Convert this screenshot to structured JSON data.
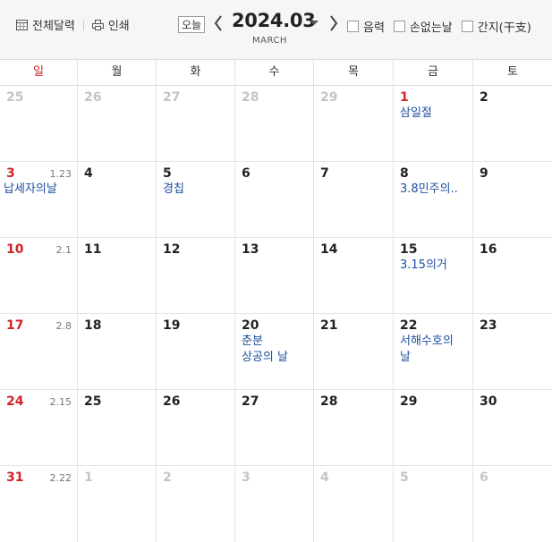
{
  "toolbar": {
    "full_calendar_label": "전체달력",
    "print_label": "인쇄",
    "today_label": "오늘",
    "year_month": "2024.03",
    "month_english": "MARCH",
    "options": [
      "음력",
      "손없는날",
      "간지(干支)"
    ]
  },
  "calendar": {
    "weekdays": [
      "일",
      "월",
      "화",
      "수",
      "목",
      "금",
      "토"
    ],
    "weeks": [
      [
        {
          "day": "25",
          "other": true
        },
        {
          "day": "26",
          "other": true
        },
        {
          "day": "27",
          "other": true
        },
        {
          "day": "28",
          "other": true
        },
        {
          "day": "29",
          "other": true
        },
        {
          "day": "1",
          "holiday": true,
          "events": [
            "삼일절"
          ]
        },
        {
          "day": "2"
        }
      ],
      [
        {
          "day": "3",
          "lunar": "1.23",
          "events": [
            "납세자의날"
          ]
        },
        {
          "day": "4"
        },
        {
          "day": "5",
          "events": [
            "경칩"
          ]
        },
        {
          "day": "6"
        },
        {
          "day": "7"
        },
        {
          "day": "8",
          "events": [
            "3.8민주의.."
          ]
        },
        {
          "day": "9"
        }
      ],
      [
        {
          "day": "10",
          "lunar": "2.1"
        },
        {
          "day": "11"
        },
        {
          "day": "12"
        },
        {
          "day": "13"
        },
        {
          "day": "14"
        },
        {
          "day": "15",
          "events": [
            "3.15의거"
          ]
        },
        {
          "day": "16"
        }
      ],
      [
        {
          "day": "17",
          "lunar": "2.8"
        },
        {
          "day": "18"
        },
        {
          "day": "19"
        },
        {
          "day": "20",
          "events": [
            "춘분",
            "상공의 날"
          ]
        },
        {
          "day": "21"
        },
        {
          "day": "22",
          "events": [
            "서해수호의",
            "날"
          ]
        },
        {
          "day": "23"
        }
      ],
      [
        {
          "day": "24",
          "lunar": "2.15"
        },
        {
          "day": "25"
        },
        {
          "day": "26"
        },
        {
          "day": "27"
        },
        {
          "day": "28"
        },
        {
          "day": "29"
        },
        {
          "day": "30"
        }
      ],
      [
        {
          "day": "31",
          "lunar": "2.22"
        },
        {
          "day": "1",
          "other": true
        },
        {
          "day": "2",
          "other": true
        },
        {
          "day": "3",
          "other": true
        },
        {
          "day": "4",
          "other": true
        },
        {
          "day": "5",
          "other": true
        },
        {
          "day": "6",
          "other": true
        }
      ]
    ]
  }
}
